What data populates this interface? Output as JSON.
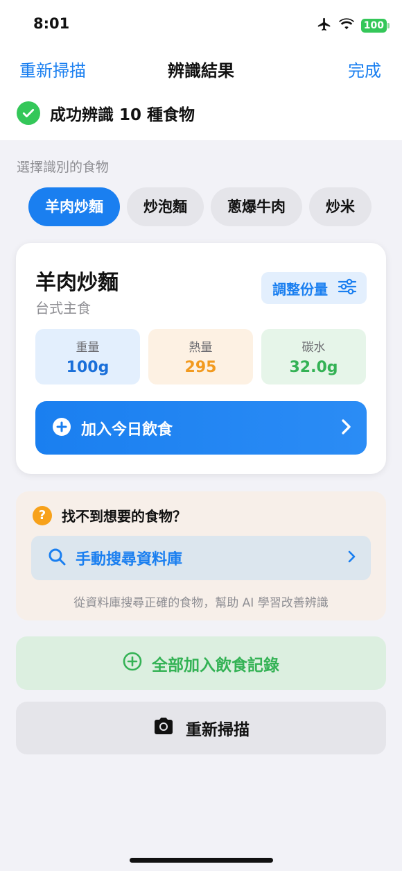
{
  "status_bar": {
    "time": "8:01",
    "battery": "100"
  },
  "nav": {
    "left": "重新掃描",
    "title": "辨識結果",
    "right": "完成"
  },
  "success": {
    "text": "成功辨識 10 種食物"
  },
  "selector": {
    "label": "選擇識別的食物",
    "chips": [
      "羊肉炒麵",
      "炒泡麵",
      "蔥爆牛肉",
      "炒米"
    ]
  },
  "food": {
    "name": "羊肉炒麵",
    "category": "台式主食",
    "adjust_label": "調整份量",
    "nutrients": [
      {
        "label": "重量",
        "value": "100g"
      },
      {
        "label": "熱量",
        "value": "295"
      },
      {
        "label": "碳水",
        "value": "32.0g"
      }
    ],
    "add_today": "加入今日飲食"
  },
  "help": {
    "title": "找不到想要的食物？",
    "search": "手動搜尋資料庫",
    "note": "從資料庫搜尋正確的食物，幫助 AI 學習改善辨識"
  },
  "actions": {
    "add_all": "全部加入飲食記錄",
    "rescan": "重新掃描"
  },
  "colors": {
    "accent": "#1a7ff0",
    "success": "#34c759",
    "warning": "#f7a11a"
  }
}
